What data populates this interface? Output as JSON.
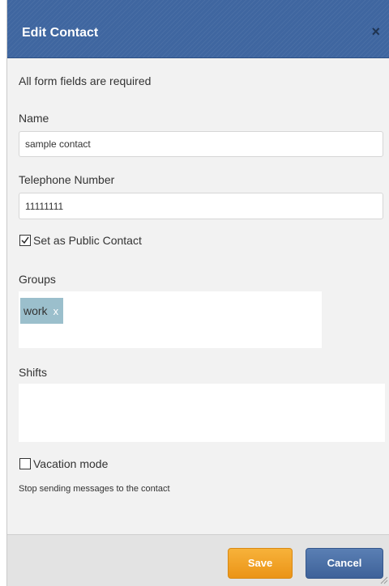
{
  "dialog": {
    "title": "Edit Contact",
    "close_icon": "close-icon",
    "close_glyph": "×"
  },
  "form": {
    "required_note": "All form fields are required",
    "name": {
      "label": "Name",
      "value": "sample contact"
    },
    "telephone": {
      "label": "Telephone Number",
      "value": "11111111"
    },
    "public_contact": {
      "label": "Set as Public Contact",
      "checked": true
    },
    "groups": {
      "label": "Groups",
      "tags": [
        {
          "label": "work",
          "remove_glyph": "x"
        }
      ]
    },
    "shifts": {
      "label": "Shifts"
    },
    "vacation_mode": {
      "label": "Vacation mode",
      "checked": false,
      "help": "Stop sending messages to the contact"
    }
  },
  "footer": {
    "save_label": "Save",
    "cancel_label": "Cancel"
  },
  "colors": {
    "titlebar": "#3f66a0",
    "save": "#f0a02a",
    "cancel": "#4a6fa8",
    "tag": "#9bbfcc"
  }
}
